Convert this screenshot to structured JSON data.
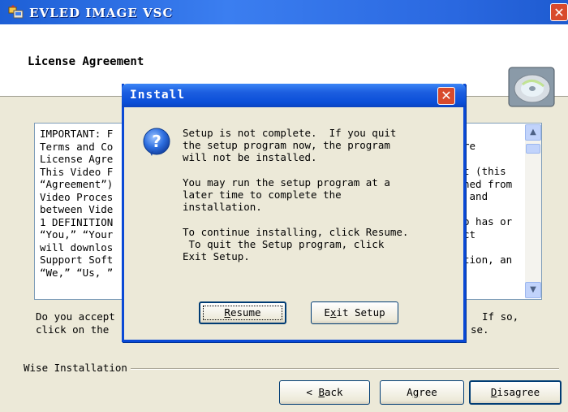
{
  "window": {
    "title": "EVLED IMAGE VSC",
    "close_glyph": "✕",
    "app_icon": "installer-icon"
  },
  "header": {
    "title": "License Agreement",
    "icon": "cd-disc-icon"
  },
  "license": {
    "text": "IMPORTANT: F\nTerms and Co\nLicense Agre\nThis Video F\n“Agreement”)\nVideo Proces\nbetween Vide\n1 DEFINITION\n“You,” “Your\nwill downlos\nSupport Soft\n“We,” “Us, ”",
    "text_right": "re\n\nt (this\nned from\n and\n\no has or\nct\n\ntion, an",
    "scroll_up": "▲",
    "scroll_down": "▼"
  },
  "question": {
    "line1_left": "Do you accept",
    "line1_right": "If so,",
    "line2_left": "click on the",
    "line2_right": "se."
  },
  "group_label": "Wise Installation",
  "buttons": {
    "back_prefix": "< ",
    "back_key": "B",
    "back_rest": "ack",
    "agree_key": "g",
    "agree_a": "A",
    "agree_rest": "ree",
    "disagree_key": "D",
    "disagree_rest": "isagree"
  },
  "dialog": {
    "title": "Install",
    "close_glyph": "✕",
    "icon": "question-icon",
    "message": "Setup is not complete.  If you quit\nthe setup program now, the program\nwill not be installed.\n\nYou may run the setup program at a\nlater time to complete the\ninstallation.\n\nTo continue installing, click Resume.\n To quit the Setup program, click\nExit Setup.",
    "resume_key": "R",
    "resume_rest": "esume",
    "exit_e": "E",
    "exit_key": "x",
    "exit_rest": "it Setup"
  },
  "colors": {
    "titlebar": "#2a68e0",
    "dialog_border": "#0a49d6",
    "close_button": "#d84a2c",
    "face": "#ece9d8"
  }
}
